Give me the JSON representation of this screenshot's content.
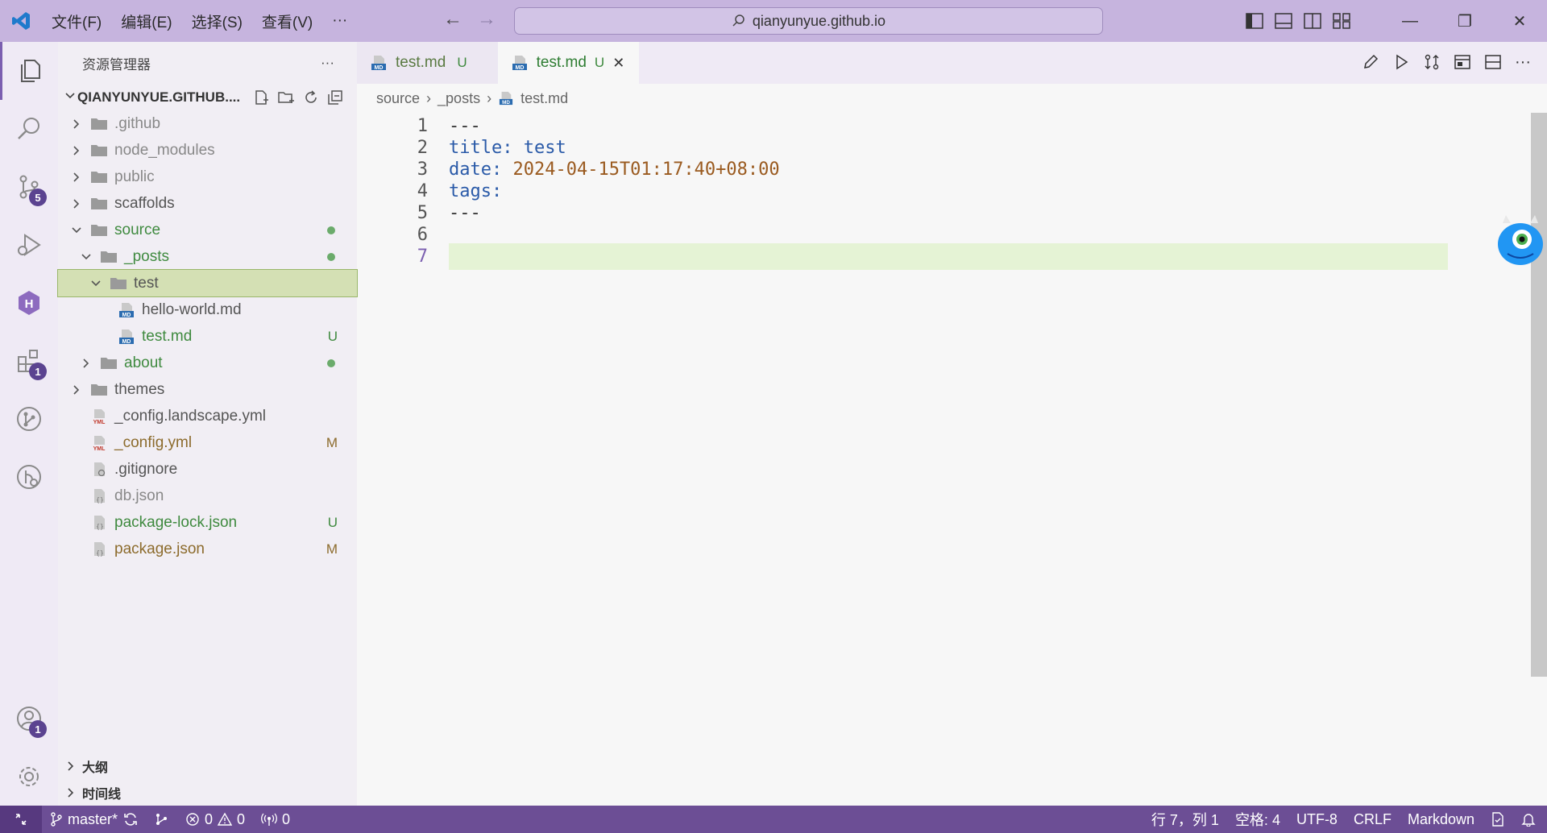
{
  "titlebar": {
    "menu": [
      "文件(F)",
      "编辑(E)",
      "选择(S)",
      "查看(V)",
      "···"
    ],
    "search_text": "qianyunyue.github.io"
  },
  "activity": {
    "scm_badge": "5",
    "extensions_badge": "1",
    "accounts_badge": "1"
  },
  "sidebar": {
    "title": "资源管理器",
    "more": "···",
    "root": "QIANYUNYUE.GITHUB....",
    "items": [
      {
        "label": ".github",
        "decoration": ""
      },
      {
        "label": "node_modules",
        "decoration": ""
      },
      {
        "label": "public",
        "decoration": ""
      },
      {
        "label": "scaffolds",
        "decoration": ""
      },
      {
        "label": "source",
        "decoration": "dot"
      },
      {
        "label": "_posts",
        "decoration": "dot"
      },
      {
        "label": "test",
        "decoration": ""
      },
      {
        "label": "hello-world.md",
        "decoration": ""
      },
      {
        "label": "test.md",
        "decoration": "U"
      },
      {
        "label": "about",
        "decoration": "dot"
      },
      {
        "label": "themes",
        "decoration": ""
      },
      {
        "label": "_config.landscape.yml",
        "decoration": ""
      },
      {
        "label": "_config.yml",
        "decoration": "M"
      },
      {
        "label": ".gitignore",
        "decoration": ""
      },
      {
        "label": "db.json",
        "decoration": ""
      },
      {
        "label": "package-lock.json",
        "decoration": "U"
      },
      {
        "label": "package.json",
        "decoration": "M"
      }
    ],
    "outline": "大纲",
    "timeline": "时间线"
  },
  "tabs": [
    {
      "label": "test.md",
      "status": "U"
    },
    {
      "label": "test.md",
      "status": "U"
    }
  ],
  "breadcrumb": [
    "source",
    "_posts",
    "test.md"
  ],
  "editor": {
    "lines": [
      {
        "num": "1",
        "key": "",
        "sep": "---",
        "val": ""
      },
      {
        "num": "2",
        "key": "title:",
        "sep": " ",
        "val": "test"
      },
      {
        "num": "3",
        "key": "date:",
        "sep": " ",
        "val": "2024-04-15T01:17:40+08:00"
      },
      {
        "num": "4",
        "key": "tags:",
        "sep": "",
        "val": ""
      },
      {
        "num": "5",
        "key": "",
        "sep": "---",
        "val": ""
      },
      {
        "num": "6",
        "key": "",
        "sep": "",
        "val": ""
      },
      {
        "num": "7",
        "key": "",
        "sep": "",
        "val": ""
      }
    ]
  },
  "statusbar": {
    "branch": "master*",
    "errors": "0",
    "warnings": "0",
    "ports": "0",
    "position": "行 7，列 1",
    "spaces": "空格: 4",
    "encoding": "UTF-8",
    "eol": "CRLF",
    "language": "Markdown"
  },
  "colors": {
    "titlebar": "#c6b4de",
    "statusbar": "#6c4e95",
    "current_line": "#e5f3d5"
  }
}
